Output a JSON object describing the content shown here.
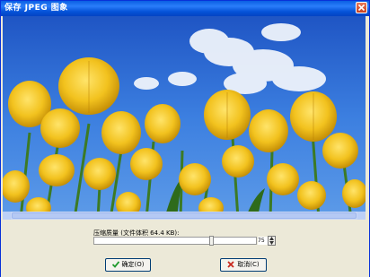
{
  "window": {
    "title": "保存 JPEG 图象"
  },
  "compression": {
    "label": "压缩质量 (文件体积 64.4 KB):",
    "value": "75",
    "level": 75
  },
  "buttons": {
    "ok_label": "确定(O)",
    "cancel_label": "取消(C)"
  },
  "colors": {
    "titlebar": "#0a5fe3",
    "sky": "#2f6ed8",
    "tulip": "#f3c623",
    "ok_icon": "#1f9a2e",
    "cancel_icon": "#c8281e"
  },
  "icons": {
    "ok": "check-icon",
    "cancel": "x-icon",
    "close": "close-icon"
  }
}
